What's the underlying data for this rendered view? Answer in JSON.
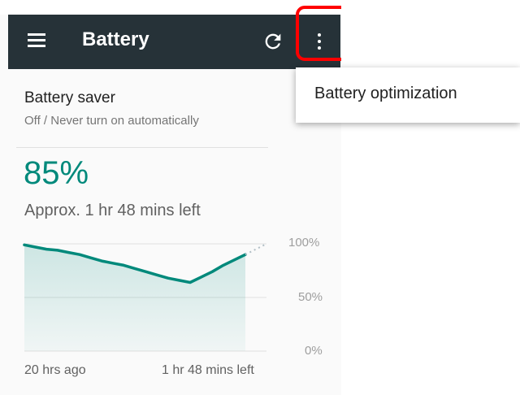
{
  "toolbar": {
    "title": "Battery",
    "background": "#263238",
    "icons": {
      "menu": "hamburger-menu-icon",
      "refresh": "refresh-icon",
      "overflow": "more-vert-icon"
    }
  },
  "battery_saver": {
    "title": "Battery saver",
    "subtitle": "Off / Never turn on automatically"
  },
  "status": {
    "percent": "85%",
    "remaining": "Approx. 1 hr 48 mins left",
    "accent": "#00897b"
  },
  "chart_data": {
    "type": "area",
    "x_start_label": "20 hrs ago",
    "x_end_label": "1 hr 48 mins left",
    "y_tick_labels": [
      "100%",
      "50%",
      "0%"
    ],
    "ylim": [
      0,
      100
    ],
    "grid": true,
    "x_hours": [
      0,
      1,
      2,
      3,
      4,
      5,
      6,
      7,
      8,
      9,
      10,
      11,
      12,
      13,
      14,
      15,
      16,
      17,
      18,
      19,
      20
    ],
    "y_percent": [
      99,
      97,
      95,
      94,
      92,
      90,
      87,
      84,
      82,
      80,
      77,
      74,
      71,
      68,
      66,
      64,
      69,
      74,
      80,
      85,
      90
    ],
    "projection_end_percent": 100
  },
  "overflow_menu": {
    "items": [
      {
        "label": "Battery optimization"
      }
    ]
  }
}
